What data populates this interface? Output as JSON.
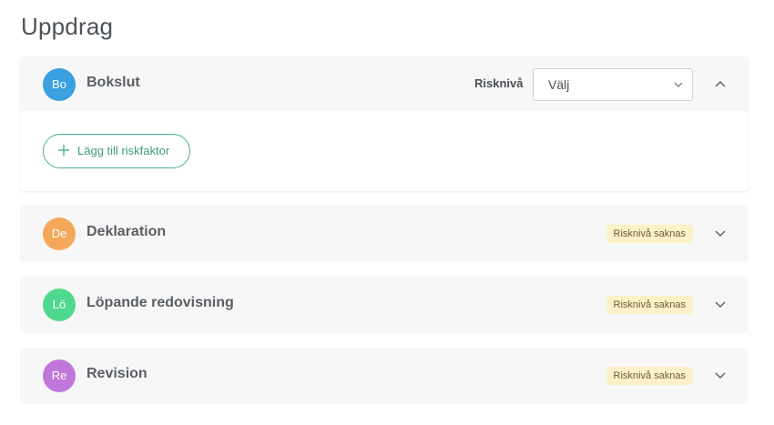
{
  "page": {
    "title": "Uppdrag"
  },
  "assignments": [
    {
      "initials": "Bo",
      "name": "Bokslut",
      "color": "#3aa0e0",
      "expanded": true,
      "risk_label": "Risknivå",
      "risk_select_value": "Välj",
      "add_risk_label": "Lägg till riskfaktor"
    },
    {
      "initials": "De",
      "name": "Deklaration",
      "color": "#f5a85a",
      "expanded": false,
      "badge": "Risknivå saknas"
    },
    {
      "initials": "Lö",
      "name": "Löpande redovisning",
      "color": "#4fd98e",
      "expanded": false,
      "badge": "Risknivå saknas"
    },
    {
      "initials": "Re",
      "name": "Revision",
      "color": "#c077db",
      "expanded": false,
      "badge": "Risknivå saknas"
    }
  ],
  "colors": {
    "accent_green": "#49b08a",
    "badge_bg": "#fdf1c8"
  },
  "icons": {
    "expanded": "chevron-up-icon",
    "collapsed": "chevron-down-icon",
    "select": "chevron-down-icon",
    "add": "plus-icon"
  }
}
